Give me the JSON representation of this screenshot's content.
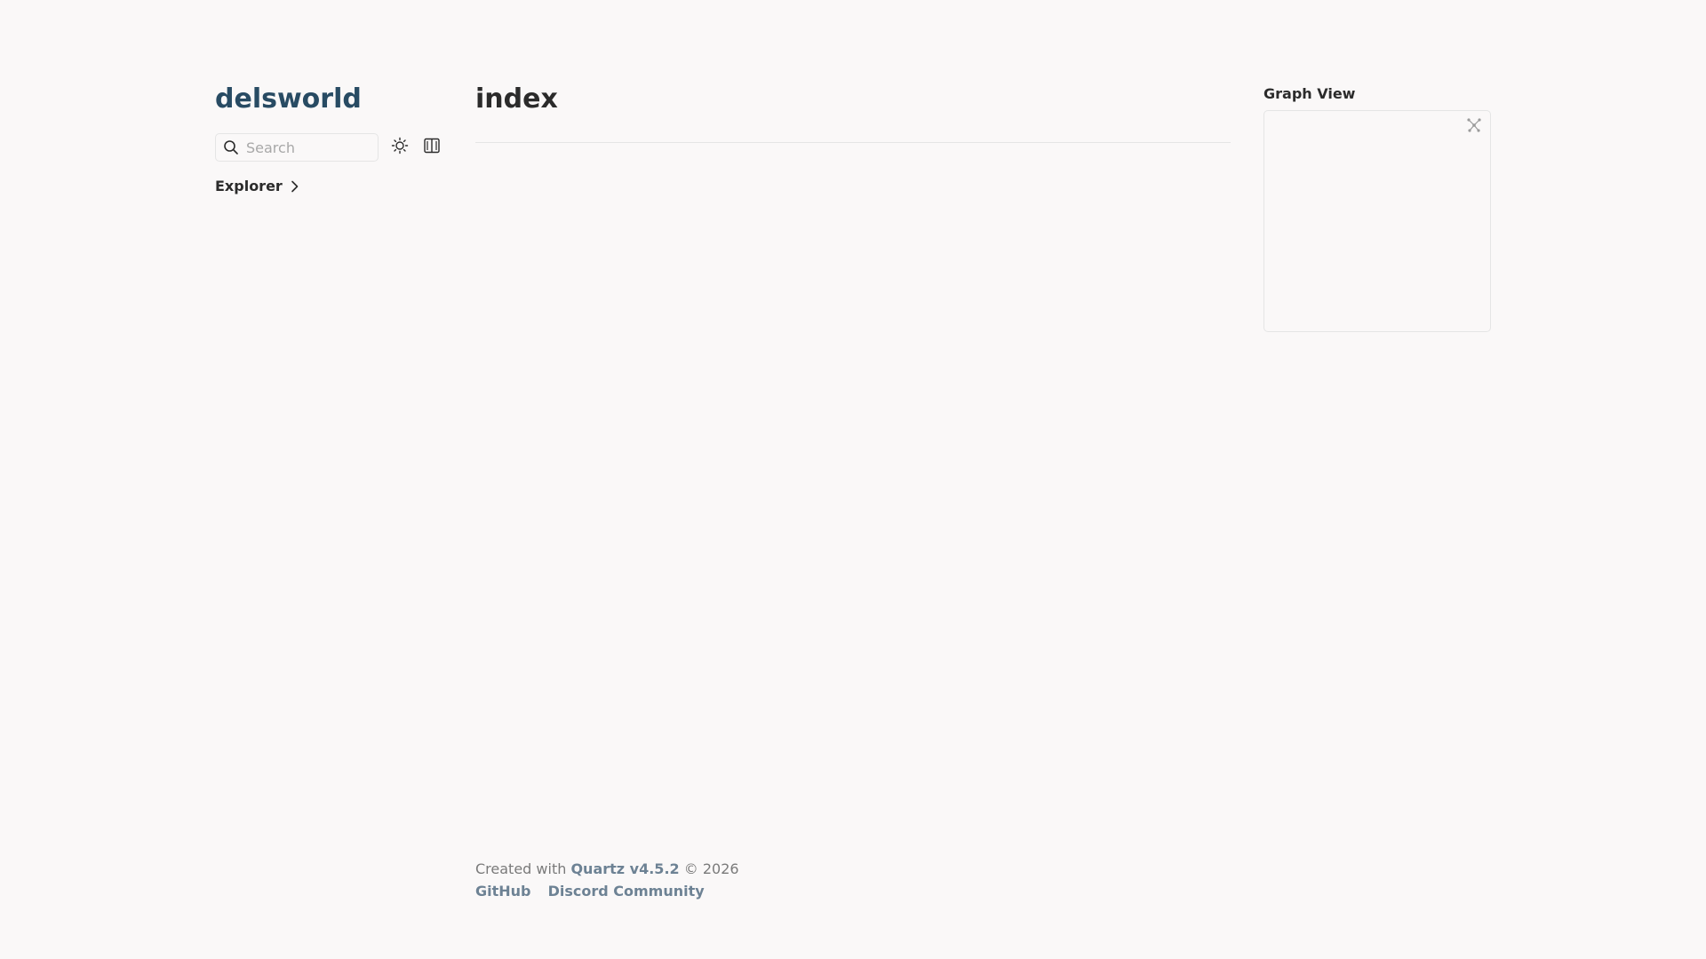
{
  "site": {
    "title": "delsworld"
  },
  "search": {
    "placeholder": "Search"
  },
  "toolbar": {
    "darkmode_icon": "sun-icon",
    "reader_icon": "book-icon"
  },
  "explorer": {
    "label": "Explorer"
  },
  "article": {
    "title": "index"
  },
  "graph": {
    "title": "Graph View",
    "expand_icon": "expand-icon"
  },
  "footer": {
    "created_prefix": "Created with",
    "quartz_link": "Quartz v4.5.2",
    "copyright": "© 2026",
    "links": [
      "GitHub",
      "Discord Community"
    ]
  },
  "colors": {
    "background": "#faf8f8",
    "title_accent": "#284b63",
    "link": "#6d8294",
    "text": "#2b2b2b",
    "border": "#e5e5e5"
  }
}
